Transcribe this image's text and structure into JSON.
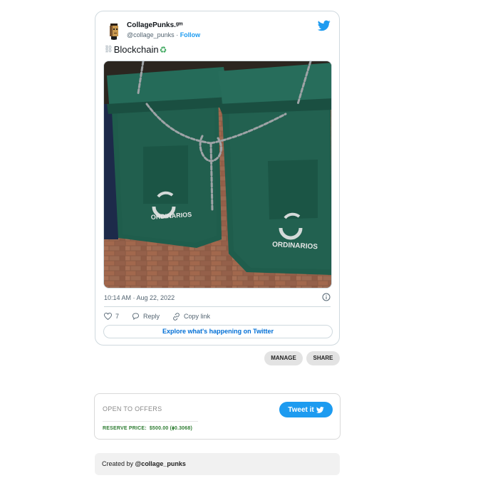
{
  "tweet": {
    "user_name": "CollagePunks.ᵍᵐ",
    "handle": "@collage_punks",
    "separator": " · ",
    "follow_label": "Follow",
    "text": "Blockchain",
    "chain_emoji": "⛓",
    "recycle_emoji": "♻",
    "timestamp": "10:14 AM · Aug 22, 2022",
    "like_count": "7",
    "reply_label": "Reply",
    "copy_link_label": "Copy link",
    "explore_label": "Explore what's happening on Twitter",
    "image_text_left": "ORDINARIOS",
    "image_text_right": "ORDINARIOS"
  },
  "actions": {
    "manage_label": "MANAGE",
    "share_label": "SHARE"
  },
  "offers": {
    "title": "OPEN TO OFFERS",
    "reserve_label": "RESERVE PRICE:",
    "reserve_value": "$500.00 (⧫0.3068)",
    "tweet_it_label": "Tweet it"
  },
  "footer": {
    "created_prefix": "Created by ",
    "created_handle": "@collage_punks"
  },
  "colors": {
    "twitter_blue": "#1d9bf0",
    "link_blue": "#006fd6",
    "reserve_green": "#2e7d32",
    "bin_green": "#1f5d4c"
  },
  "icons": [
    "avatar-punk-icon",
    "twitter-bird-icon",
    "info-icon",
    "heart-icon",
    "reply-bubble-icon",
    "link-icon"
  ]
}
